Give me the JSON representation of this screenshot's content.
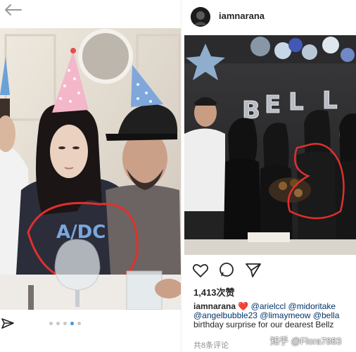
{
  "left_post": {
    "photo_alt": "",
    "carousel": {
      "count": 5,
      "active_index": 3
    }
  },
  "right_post": {
    "username": "iamnarana",
    "likes": "1,413次赞",
    "caption": {
      "user": "iamnarana",
      "heart": "❤️",
      "line1_mentions": [
        "@arielccl",
        "@midoritake"
      ],
      "line2_mentions": [
        "@angelbubble23",
        "@limaymeow",
        "@bella"
      ],
      "line3_text": "birthday surprise for our dearest Bellz"
    },
    "comments": "共8条评论",
    "balloon_text": "B E L L",
    "watermark": "知乎 @Flora7883"
  },
  "icons": [
    "back-arrow-icon",
    "share-icon",
    "heart-icon",
    "comment-icon",
    "send-icon"
  ],
  "colors": {
    "mention": "#003569",
    "active_dot": "#3897f0",
    "text": "#262626",
    "muted": "#8e8e8e"
  }
}
